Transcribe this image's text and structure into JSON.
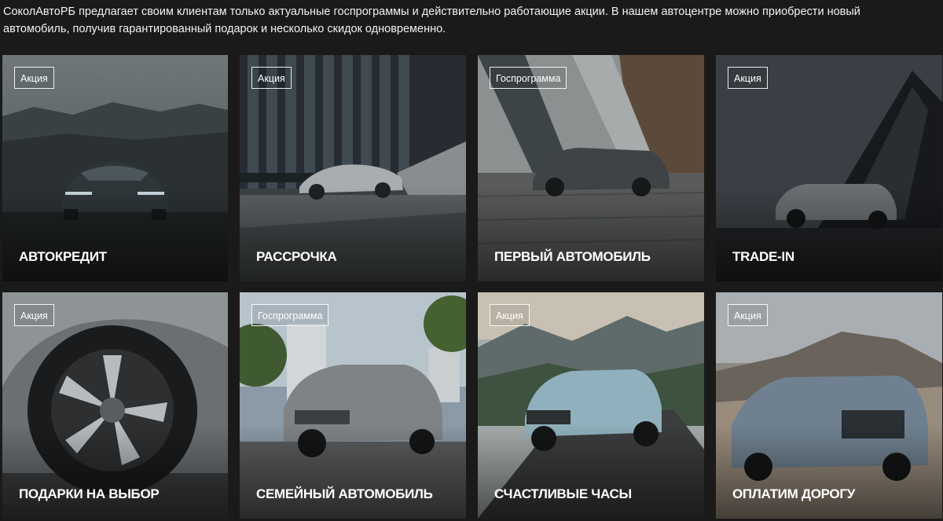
{
  "intro": {
    "line1": "СоколАвтоРБ предлагает своим клиентам только актуальные госпрограммы и действительно работающие акции. В нашем автоцентре можно приобрести новый",
    "line2": "автомобиль, получив гарантированный подарок и несколько скидок одновременно."
  },
  "cards": [
    {
      "badge": "Акция",
      "title": "АВТОКРЕДИТ",
      "icon": "car-front-dark-image"
    },
    {
      "badge": "Акция",
      "title": "РАССРОЧКА",
      "icon": "coupe-building-image"
    },
    {
      "badge": "Госпрограмма",
      "title": "ПЕРВЫЙ АВТОМОБИЛЬ",
      "icon": "wagon-cobblestone-image"
    },
    {
      "badge": "Акция",
      "title": "TRADE-IN",
      "icon": "suv-dark-architecture-image"
    },
    {
      "badge": "Акция",
      "title": "ПОДАРКИ НА ВЫБОР",
      "icon": "wheel-closeup-image"
    },
    {
      "badge": "Госпрограмма",
      "title": "СЕМЕЙНЫЙ АВТОМОБИЛЬ",
      "icon": "crossover-city-image"
    },
    {
      "badge": "Акция",
      "title": "СЧАСТЛИВЫЕ ЧАСЫ",
      "icon": "offroad-suv-mountains-image"
    },
    {
      "badge": "Акция",
      "title": "ОПЛАТИМ ДОРОГУ",
      "icon": "large-suv-desert-image"
    }
  ],
  "colors": {
    "background": "#1b1a1a",
    "text": "#ffffff"
  }
}
